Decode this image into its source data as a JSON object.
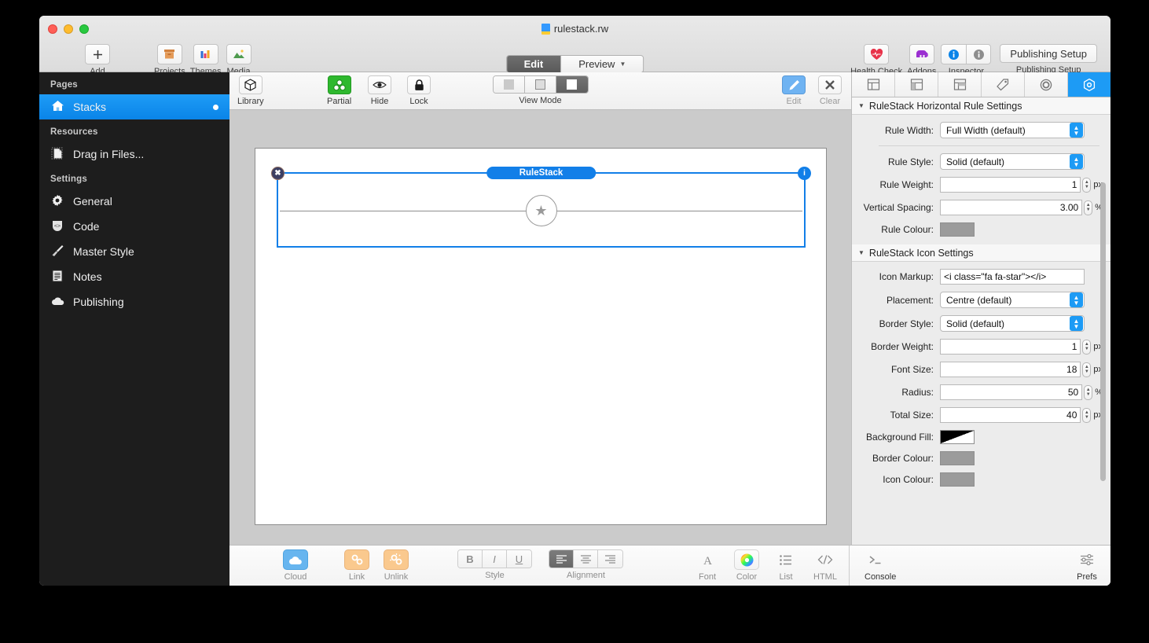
{
  "window": {
    "document_title": "rulestack.rw"
  },
  "toolbar": {
    "left_items": [
      {
        "label": "Add",
        "icon": "plus-icon"
      },
      {
        "label": "Projects",
        "icon": "archive-box-icon"
      },
      {
        "label": "Themes",
        "icon": "themes-icon"
      },
      {
        "label": "Media",
        "icon": "media-image-icon"
      }
    ],
    "modes": [
      {
        "label": "Edit",
        "active": true
      },
      {
        "label": "Preview",
        "active": false,
        "has_menu": true
      }
    ],
    "right_items": [
      {
        "label": "Health Check",
        "icon": "heart-icon"
      },
      {
        "label": "Addons",
        "icon": "elephant-icon"
      },
      {
        "label": "Inspector",
        "icon": "info-circle-icon"
      }
    ],
    "publishing_button": "Publishing Setup",
    "publishing_label": "Publishing Setup"
  },
  "sidebar": {
    "sections": [
      {
        "header": "Pages",
        "items": [
          {
            "label": "Stacks",
            "icon": "home-icon",
            "active": true,
            "dot": true
          }
        ]
      },
      {
        "header": "Resources",
        "items": [
          {
            "label": "Drag in Files...",
            "icon": "document-dashed-icon",
            "active": false,
            "dot": false
          }
        ]
      },
      {
        "header": "Settings",
        "items": [
          {
            "label": "General",
            "icon": "gear-icon",
            "active": false,
            "dot": false
          },
          {
            "label": "Code",
            "icon": "code-shield-icon",
            "active": false,
            "dot": false
          },
          {
            "label": "Master Style",
            "icon": "paintbrush-icon",
            "active": false,
            "dot": false
          },
          {
            "label": "Notes",
            "icon": "notes-icon",
            "active": false,
            "dot": false
          },
          {
            "label": "Publishing",
            "icon": "cloud-icon",
            "active": false,
            "dot": false
          }
        ]
      }
    ]
  },
  "subtoolbar": {
    "library": "Library",
    "partial": "Partial",
    "hide": "Hide",
    "lock": "Lock",
    "view_mode_label": "View Mode",
    "view_mode_selected_index": 2,
    "edit": "Edit",
    "clear": "Clear"
  },
  "canvas": {
    "stack": {
      "title": "RuleStack",
      "close_glyph": "✖",
      "info_glyph": "i",
      "icon_glyph": "★"
    }
  },
  "inspector": {
    "tabs": [
      {
        "icon": "layout-top-icon",
        "active": false
      },
      {
        "icon": "layout-left-icon",
        "active": false
      },
      {
        "icon": "layout-right-icon",
        "active": false
      },
      {
        "icon": "tag-icon",
        "active": false
      },
      {
        "icon": "circle-target-icon",
        "active": false
      },
      {
        "icon": "hex-stack-icon",
        "active": true
      }
    ],
    "sections": [
      {
        "title": "RuleStack Horizontal Rule Settings",
        "rows": [
          {
            "label": "Rule Width:",
            "type": "popup",
            "value": "Full Width (default)"
          },
          {
            "type": "divider"
          },
          {
            "label": "Rule Style:",
            "type": "popup",
            "value": "Solid (default)"
          },
          {
            "label": "Rule Weight:",
            "type": "stepper",
            "value": "1",
            "unit": "px"
          },
          {
            "label": "Vertical Spacing:",
            "type": "stepper",
            "value": "3.00",
            "unit": "%"
          },
          {
            "label": "Rule Colour:",
            "type": "colour",
            "colour": "#9b9b9b"
          }
        ]
      },
      {
        "title": "RuleStack Icon Settings",
        "rows": [
          {
            "label": "Icon Markup:",
            "type": "text",
            "value": "<i class=\"fa fa-star\"></i>"
          },
          {
            "label": "Placement:",
            "type": "popup",
            "value": "Centre (default)"
          },
          {
            "label": "Border Style:",
            "type": "popup",
            "value": "Solid (default)"
          },
          {
            "label": "Border Weight:",
            "type": "stepper",
            "value": "1",
            "unit": "px"
          },
          {
            "label": "Font Size:",
            "type": "stepper",
            "value": "18",
            "unit": "px"
          },
          {
            "label": "Radius:",
            "type": "stepper",
            "value": "50",
            "unit": "%"
          },
          {
            "label": "Total Size:",
            "type": "stepper",
            "value": "40",
            "unit": "px"
          },
          {
            "label": "Background Fill:",
            "type": "gradient"
          },
          {
            "label": "Border Colour:",
            "type": "colour",
            "colour": "#9b9b9b"
          },
          {
            "label": "Icon Colour:",
            "type": "colour",
            "colour": "#9b9b9b"
          }
        ]
      }
    ]
  },
  "bottombar": {
    "cloud": "Cloud",
    "link": "Link",
    "unlink": "Unlink",
    "style_label": "Style",
    "style_buttons": [
      "B",
      "I",
      "U"
    ],
    "alignment_label": "Alignment",
    "font": "Font",
    "color": "Color",
    "list": "List",
    "html": "HTML",
    "console": "Console",
    "prefs": "Prefs"
  },
  "colors": {
    "accent": "#127fe8",
    "sidebar_bg": "#1d1d1d",
    "toolbar_bg": "#e9e9e9"
  }
}
